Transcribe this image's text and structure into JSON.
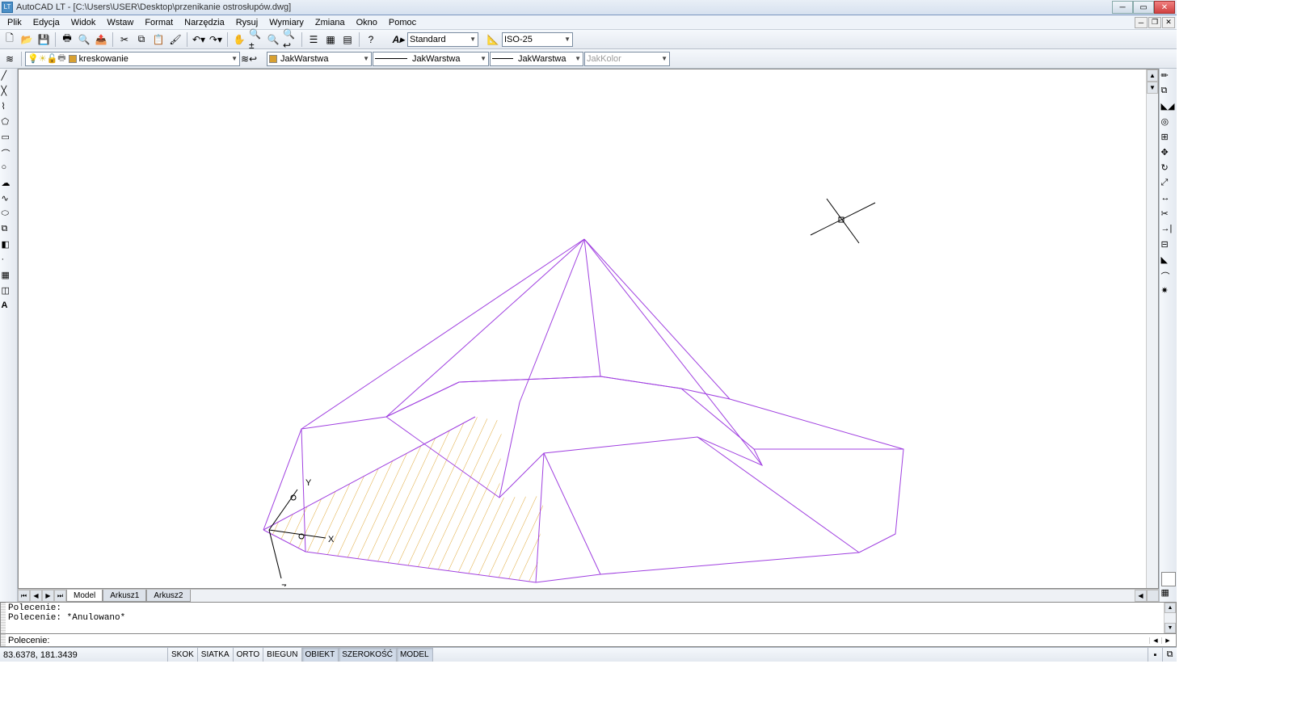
{
  "title": "AutoCAD LT - [C:\\Users\\USER\\Desktop\\przenikanie ostrosłupów.dwg]",
  "menu": [
    "Plik",
    "Edycja",
    "Widok",
    "Wstaw",
    "Format",
    "Narzędzia",
    "Rysuj",
    "Wymiary",
    "Zmiana",
    "Okno",
    "Pomoc"
  ],
  "toolbar1": {
    "style_label": "Standard",
    "dimstyle_label": "ISO-25"
  },
  "toolbar2": {
    "layer_label": "kreskowanie",
    "linetype": "JakWarstwa",
    "lineweight": "JakWarstwa",
    "plotstyle": "JakWarstwa",
    "color": "JakKolor"
  },
  "tabs": [
    "Model",
    "Arkusz1",
    "Arkusz2"
  ],
  "command_history": "Polecenie:\nPolecenie: *Anulowano*",
  "command_prompt": "Polecenie:",
  "status": {
    "coords": "83.6378, 181.3439",
    "toggles": [
      "SKOK",
      "SIATKA",
      "ORTO",
      "BIEGUN",
      "OBIEKT",
      "SZEROKOŚĆ",
      "MODEL"
    ],
    "active_toggles": [
      "OBIEKT",
      "SZEROKOŚĆ",
      "MODEL"
    ]
  },
  "ucs": {
    "x": "X",
    "y": "Y",
    "z": "Z"
  }
}
